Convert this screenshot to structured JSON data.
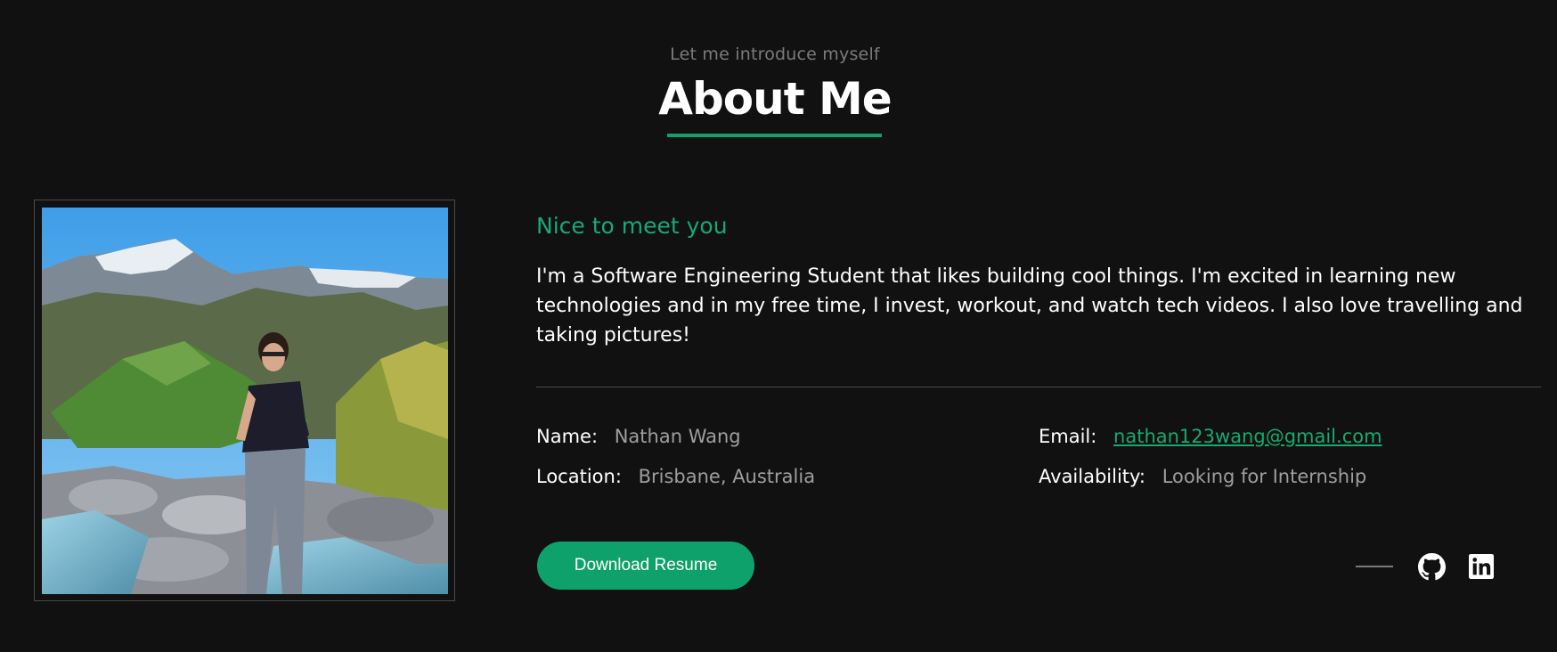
{
  "header": {
    "subtitle": "Let me introduce myself",
    "title": "About Me"
  },
  "photo": {
    "icon": "profile-photo"
  },
  "about": {
    "greeting": "Nice to meet you",
    "bio": "I'm a Software Engineering Student that likes building cool things. I'm excited in learning new technologies and in my free time, I invest, workout, and watch tech videos. I also love travelling and taking pictures!"
  },
  "details": {
    "name_label": "Name:",
    "name_value": "Nathan Wang",
    "email_label": "Email:",
    "email_value": "nathan123wang@gmail.com",
    "location_label": "Location:",
    "location_value": "Brisbane, Australia",
    "availability_label": "Availability:",
    "availability_value": "Looking for Internship"
  },
  "actions": {
    "download_label": "Download Resume"
  },
  "social": {
    "github_icon": "github-icon",
    "linkedin_icon": "linkedin-icon"
  },
  "colors": {
    "background": "#111111",
    "accent": "#0ea16c",
    "accent_text": "#18a874",
    "muted_text": "#9e9e9e"
  }
}
